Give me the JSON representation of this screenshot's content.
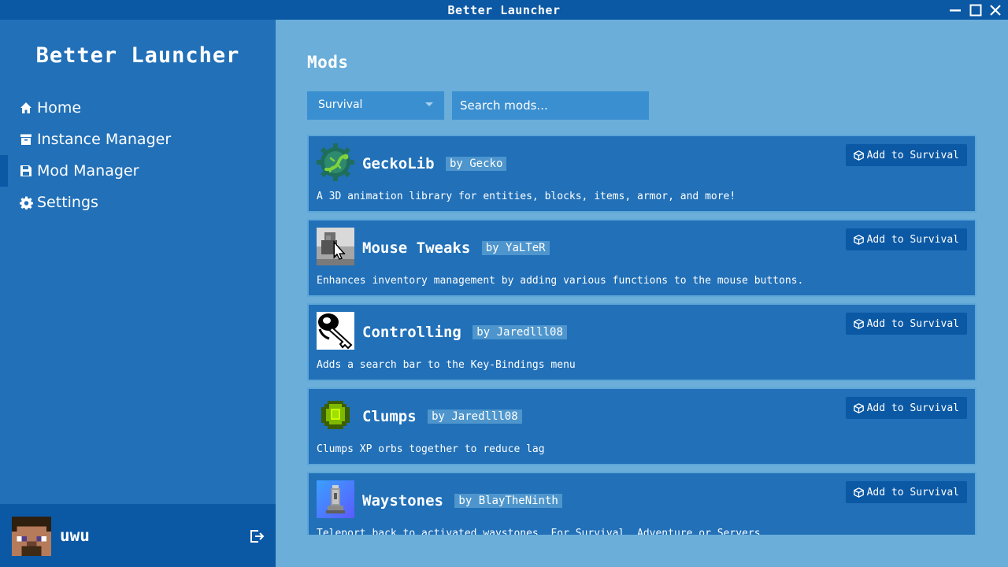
{
  "window": {
    "title": "Better Launcher"
  },
  "sidebar": {
    "brand": "Better Launcher",
    "items": [
      {
        "label": "Home",
        "icon": "home-icon"
      },
      {
        "label": "Instance Manager",
        "icon": "archive-icon"
      },
      {
        "label": "Mod Manager",
        "icon": "floppy-icon",
        "active": true
      },
      {
        "label": "Settings",
        "icon": "gear-icon"
      }
    ],
    "user": {
      "name": "uwu"
    }
  },
  "main": {
    "title": "Mods",
    "filter": {
      "selected": "Survival"
    },
    "search": {
      "placeholder": "Search mods..."
    },
    "mods": [
      {
        "name": "GeckoLib",
        "author": "by Gecko",
        "description": "A 3D animation library for entities, blocks, items, armor, and more!",
        "action": "Add to Survival",
        "icon": "gecko-logo-icon"
      },
      {
        "name": "Mouse Tweaks",
        "author": "by YaLTeR",
        "description": "Enhances inventory management by adding various functions to the mouse buttons.",
        "action": "Add to Survival",
        "icon": "mouse-cursor-icon"
      },
      {
        "name": "Controlling",
        "author": "by Jaredlll08",
        "description": "Adds a search bar to the Key-Bindings menu",
        "action": "Add to Survival",
        "icon": "key-icon"
      },
      {
        "name": "Clumps",
        "author": "by Jaredlll08",
        "description": "Clumps XP orbs together to reduce lag",
        "action": "Add to Survival",
        "icon": "xp-orb-icon"
      },
      {
        "name": "Waystones",
        "author": "by BlayTheNinth",
        "description": "Teleport back to activated waystones. For Survival, Adventure or Servers.",
        "action": "Add to Survival",
        "icon": "waystone-icon"
      }
    ]
  },
  "colors": {
    "titlebar": "#0b58a4",
    "sidebar": "#2170b8",
    "main_bg": "#6aaed9",
    "card": "#2170b8",
    "button": "#0b58a4",
    "input": "#3a8fd0"
  }
}
